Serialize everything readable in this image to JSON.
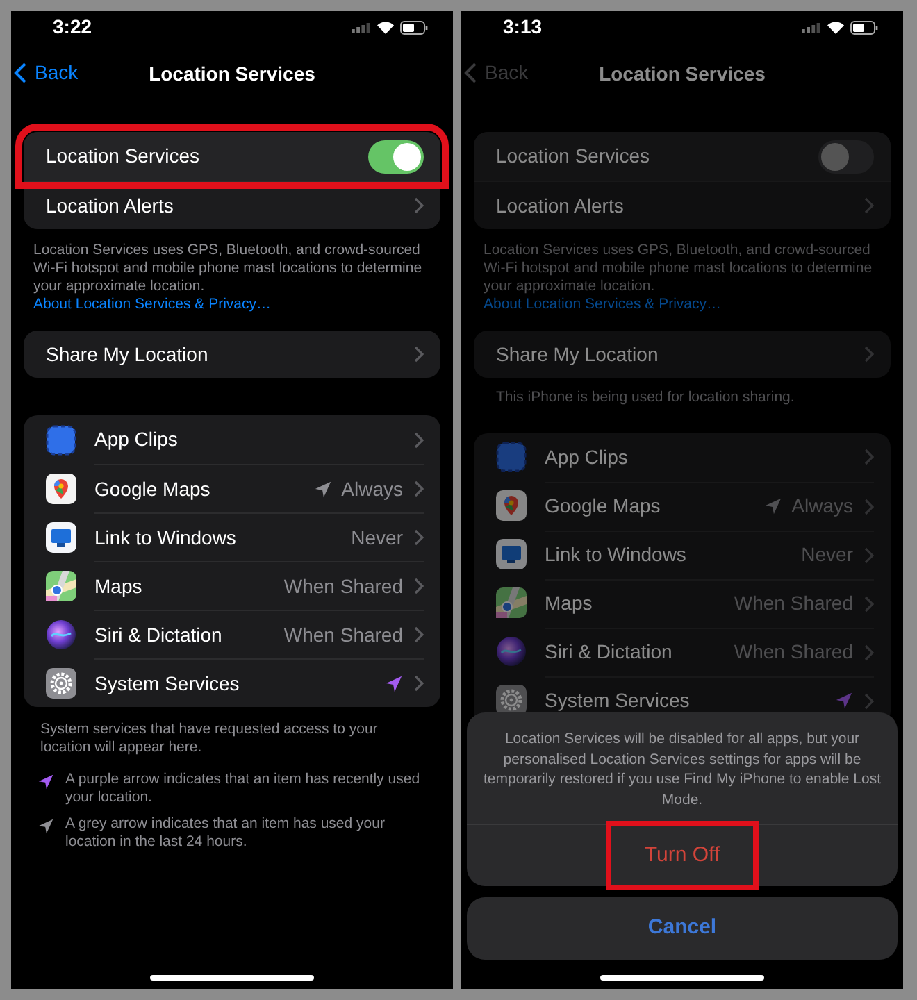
{
  "screens": [
    {
      "status_bar": {
        "time": "3:22"
      },
      "back": {
        "label": "Back",
        "disabled": false
      },
      "title": "Location Services",
      "toggle": {
        "label": "Location Services",
        "on": true,
        "highlighted": true
      },
      "alerts": {
        "label": "Location Alerts"
      },
      "footer": {
        "text": "Location Services uses GPS, Bluetooth, and crowd-sourced Wi-Fi hotspot and mobile phone mast locations to determine your approximate location.",
        "link": "About Location Services & Privacy…"
      },
      "share": {
        "label": "Share My Location"
      },
      "apps": [
        {
          "name": "App Clips",
          "kind": "clips"
        },
        {
          "name": "Google Maps",
          "kind": "pin",
          "value": "Always",
          "arrow": {
            "color": "#8e8e93"
          }
        },
        {
          "name": "Link to Windows",
          "kind": "monitor",
          "value": "Never"
        },
        {
          "name": "Maps",
          "kind": "map",
          "value": "When Shared"
        },
        {
          "name": "Siri & Dictation",
          "kind": "siri",
          "value": "When Shared"
        },
        {
          "name": "System Services",
          "kind": "gear",
          "arrow": {
            "color": "#a35bf0"
          }
        }
      ],
      "system_note": "System services that have requested access to your location will appear here.",
      "legend": [
        {
          "arrow": {
            "color": "#a35bf0"
          },
          "text": "A purple arrow indicates that an item has recently used your location."
        },
        {
          "arrow": {
            "color": "#8e8e93"
          },
          "text": "A grey arrow indicates that an item has used your location in the last 24 hours."
        }
      ]
    },
    {
      "status_bar": {
        "time": "3:13"
      },
      "back": {
        "label": "Back",
        "disabled": true
      },
      "title": "Location Services",
      "toggle": {
        "label": "Location Services",
        "on": false,
        "highlighted": false
      },
      "alerts": {
        "label": "Location Alerts"
      },
      "footer": {
        "text": "Location Services uses GPS, Bluetooth, and crowd-sourced Wi-Fi hotspot and mobile phone mast locations to determine your approximate location.",
        "link": "About Location Services & Privacy…"
      },
      "share": {
        "label": "Share My Location"
      },
      "share_note": "This iPhone is being used for location sharing.",
      "apps": [
        {
          "name": "App Clips",
          "kind": "clips"
        },
        {
          "name": "Google Maps",
          "kind": "pin",
          "value": "Always",
          "arrow": {
            "color": "#505053"
          }
        },
        {
          "name": "Link to Windows",
          "kind": "monitor",
          "value": "Never"
        },
        {
          "name": "Maps",
          "kind": "map",
          "value": "When Shared"
        },
        {
          "name": "Siri & Dictation",
          "kind": "siri",
          "value": "When Shared"
        },
        {
          "name": "System Services",
          "kind": "gear",
          "arrow": {
            "color": "#5c3488"
          }
        }
      ],
      "sheet": {
        "message": "Location Services will be disabled for all apps, but your personalised Location Services settings for apps will be temporarily restored if you use Find My iPhone to enable Lost Mode.",
        "confirm": {
          "label": "Turn Off",
          "highlighted": true
        },
        "cancel": "Cancel"
      }
    }
  ]
}
